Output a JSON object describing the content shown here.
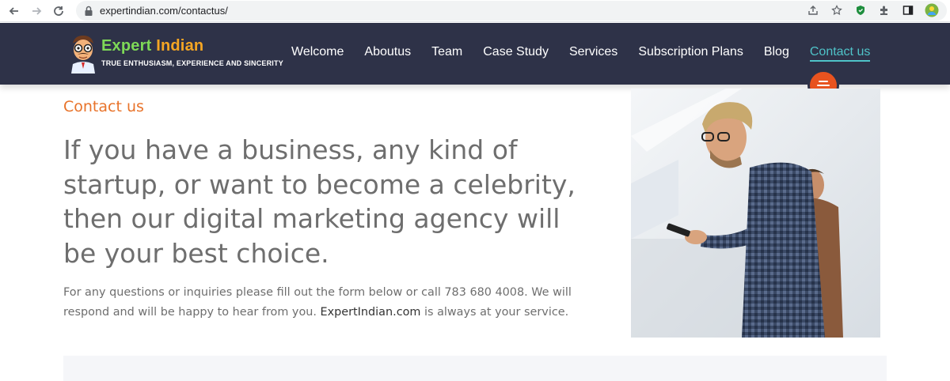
{
  "browser": {
    "url": "expertindian.com/contactus/"
  },
  "header": {
    "brand_part1": "Expert",
    "brand_part2": "Indian",
    "tagline": "TRUE ENTHUSIASM, EXPERIENCE AND SINCERITY",
    "nav": [
      {
        "label": "Welcome"
      },
      {
        "label": "Aboutus"
      },
      {
        "label": "Team"
      },
      {
        "label": "Case Study"
      },
      {
        "label": "Services"
      },
      {
        "label": "Subscription Plans"
      },
      {
        "label": "Blog"
      },
      {
        "label": "Contact us"
      }
    ],
    "active_nav": "Contact us"
  },
  "content": {
    "eyebrow": "Contact us",
    "headline": "If you have a business, any kind of startup, or want to become a celebrity, then our digital marketing agency will be your best choice.",
    "body_before": "For any questions or inquiries please fill out the form below or call 783 680 4008. We will respond and will be happy to hear from you. ",
    "body_link": "ExpertIndian.com",
    "body_after": " is always at your service."
  },
  "colors": {
    "header_bg": "#2e3248",
    "accent_orange": "#e8732a",
    "active_teal": "#4fc3c8",
    "fab": "#e8531f"
  }
}
